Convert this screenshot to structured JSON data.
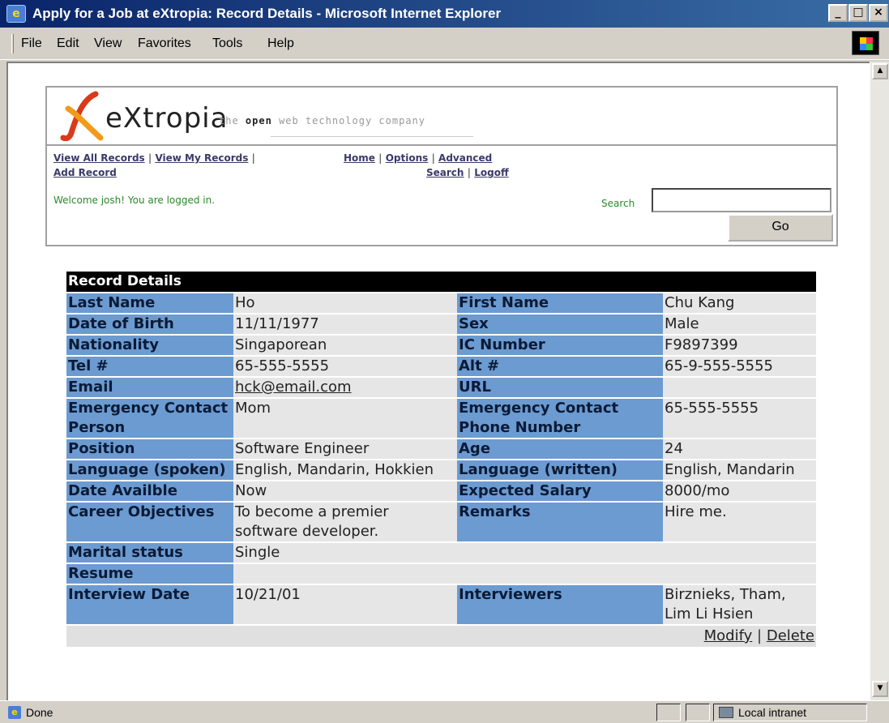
{
  "window": {
    "title": "Apply for a Job at eXtropia: Record Details - Microsoft Internet Explorer",
    "menu": [
      "File",
      "Edit",
      "View",
      "Favorites",
      "Tools",
      "Help"
    ]
  },
  "header": {
    "logo_text": "eXtropia",
    "tagline_pre": "the",
    "tagline_bold": "open",
    "tagline_post": "web technology company",
    "nav": {
      "view_all": "View All Records",
      "view_my": "View My Records",
      "add_record": "Add Record",
      "home": "Home",
      "options": "Options",
      "advanced_search_1": "Advanced",
      "advanced_search_2": "Search",
      "logoff": "Logoff",
      "separator": "|"
    },
    "welcome": "Welcome josh! You are logged in.",
    "search_label": "Search",
    "search_value": "",
    "go_label": "Go"
  },
  "record": {
    "heading": "Record Details",
    "rows": [
      {
        "l1": "Last Name",
        "v1": "Ho",
        "l2": "First Name",
        "v2": "Chu Kang"
      },
      {
        "l1": "Date of Birth",
        "v1": "11/11/1977",
        "l2": "Sex",
        "v2": "Male"
      },
      {
        "l1": "Nationality",
        "v1": "Singaporean",
        "l2": "IC Number",
        "v2": "F9897399"
      },
      {
        "l1": "Tel #",
        "v1": "65-555-5555",
        "l2": "Alt #",
        "v2": "65-9-555-5555"
      },
      {
        "l1": "Email",
        "v1": "hck@email.com",
        "l2": "URL",
        "v2": ""
      },
      {
        "l1": "Emergency Contact Person",
        "v1": "Mom",
        "l2": "Emergency Contact Phone Number",
        "v2": "65-555-5555"
      },
      {
        "l1": "Position",
        "v1": "Software Engineer",
        "l2": "Age",
        "v2": "24"
      },
      {
        "l1": "Language (spoken)",
        "v1": "English, Mandarin, Hokkien",
        "l2": "Language (written)",
        "v2": "English, Mandarin"
      },
      {
        "l1": "Date Availble",
        "v1": "Now",
        "l2": "Expected Salary",
        "v2": "8000/mo"
      },
      {
        "l1": "Career Objectives",
        "v1": "To become a premier software developer.",
        "l2": "Remarks",
        "v2": "Hire me."
      }
    ],
    "marital_label": "Marital status",
    "marital_value": "Single",
    "resume_label": "Resume",
    "resume_value": "",
    "interview_date_label": "Interview Date",
    "interview_date_value": "10/21/01",
    "interviewers_label": "Interviewers",
    "interviewers_value": "Birznieks, Tham, Lim Li Hsien",
    "modify": "Modify",
    "delete": "Delete",
    "action_sep": "|"
  },
  "status": {
    "text": "Done",
    "zone": "Local intranet"
  }
}
